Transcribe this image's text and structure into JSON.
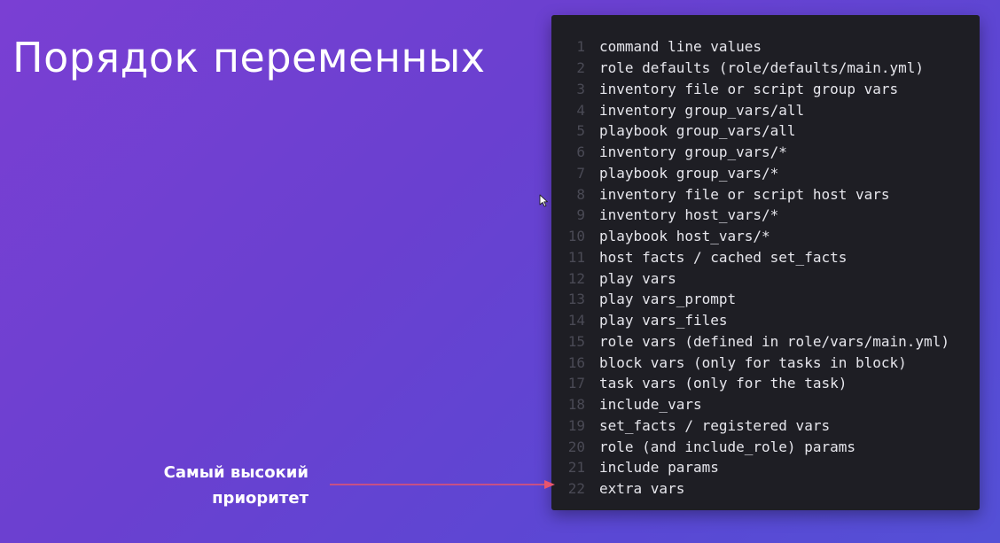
{
  "slide": {
    "title": "Порядок переменных",
    "priority_note_line1": "Самый высокий",
    "priority_note_line2": "приоритет"
  },
  "code": {
    "lines": [
      {
        "number": "1",
        "text": "command line values"
      },
      {
        "number": "2",
        "text": "role defaults (role/defaults/main.yml)"
      },
      {
        "number": "3",
        "text": "inventory file or script group vars"
      },
      {
        "number": "4",
        "text": "inventory group_vars/all"
      },
      {
        "number": "5",
        "text": "playbook group_vars/all"
      },
      {
        "number": "6",
        "text": "inventory group_vars/*"
      },
      {
        "number": "7",
        "text": "playbook group_vars/*"
      },
      {
        "number": "8",
        "text": "inventory file or script host vars"
      },
      {
        "number": "9",
        "text": "inventory host_vars/*"
      },
      {
        "number": "10",
        "text": "playbook host_vars/*"
      },
      {
        "number": "11",
        "text": "host facts / cached set_facts"
      },
      {
        "number": "12",
        "text": "play vars"
      },
      {
        "number": "13",
        "text": "play vars_prompt"
      },
      {
        "number": "14",
        "text": "play vars_files"
      },
      {
        "number": "15",
        "text": "role vars (defined in role/vars/main.yml)"
      },
      {
        "number": "16",
        "text": "block vars (only for tasks in block)"
      },
      {
        "number": "17",
        "text": "task vars (only for the task)"
      },
      {
        "number": "18",
        "text": "include_vars"
      },
      {
        "number": "19",
        "text": "set_facts / registered vars"
      },
      {
        "number": "20",
        "text": "role (and include_role) params"
      },
      {
        "number": "21",
        "text": "include params"
      },
      {
        "number": "22",
        "text": "extra vars"
      }
    ]
  },
  "colors": {
    "background_start": "#7a3fd3",
    "background_end": "#5450d6",
    "code_background": "#1e1e24",
    "code_text": "#e6e6ec",
    "line_number": "#4a4a55",
    "arrow": "#e8556d"
  }
}
